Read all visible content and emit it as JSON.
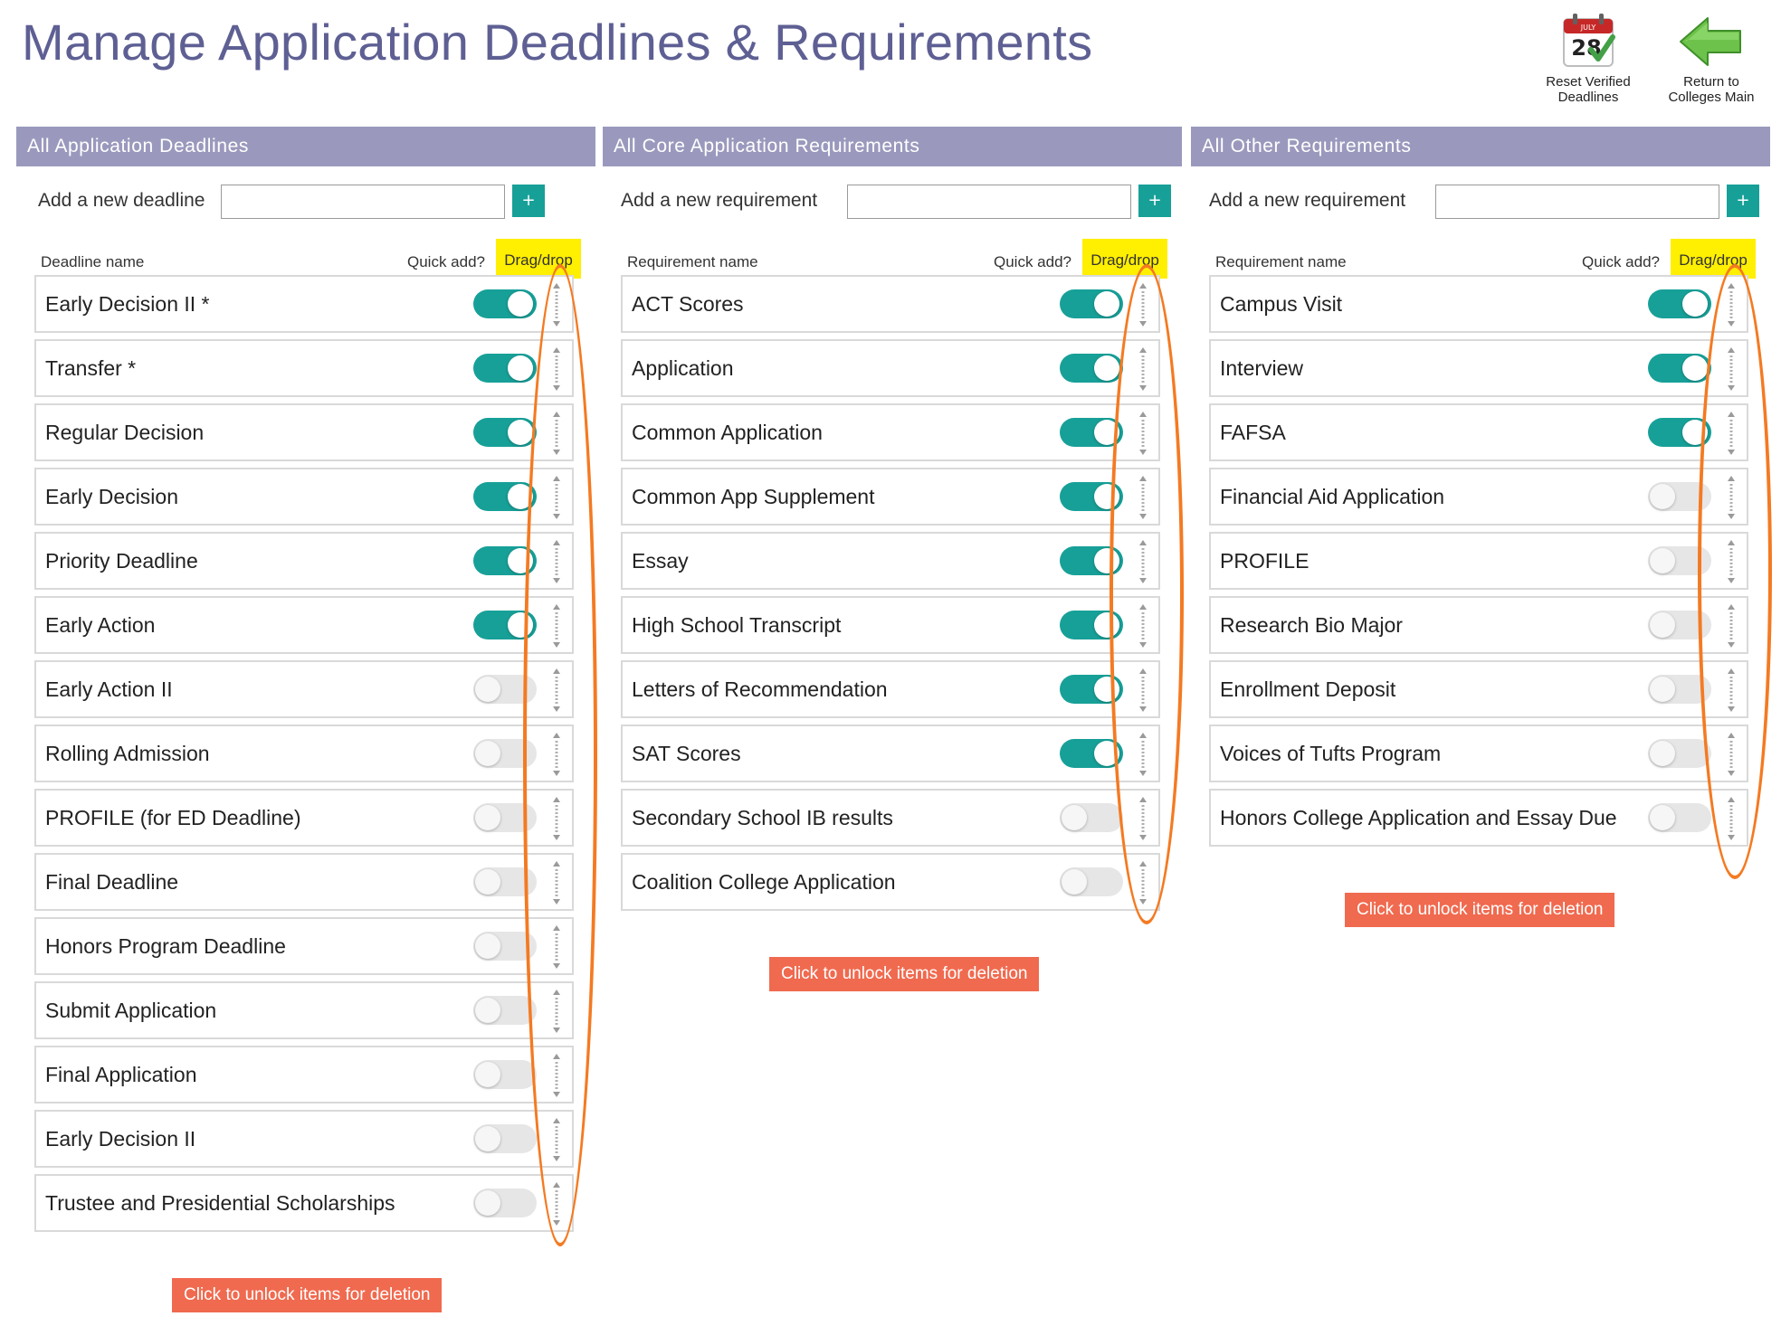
{
  "page": {
    "title": "Manage Application Deadlines & Requirements"
  },
  "top_actions": {
    "reset": {
      "label": "Reset Verified Deadlines",
      "icon": "calendar-check-icon",
      "cal_month": "JULY",
      "cal_day": "28"
    },
    "return": {
      "label": "Return to Colleges Main",
      "icon": "green-back-arrow-icon"
    }
  },
  "colors": {
    "accent": "#17a098",
    "header": "#9a99bd",
    "title": "#5e5f93",
    "unlock": "#f06a4f",
    "highlight": "#ffef00",
    "annotation": "#f47a22"
  },
  "panels": [
    {
      "title": "All Application Deadlines",
      "add_label": "Add a new deadline",
      "add_value": "",
      "add_button": "+",
      "col_name": "Deadline name",
      "col_quick": "Quick add?",
      "col_drag": "Drag/drop",
      "unlock_label": "Click to unlock items for deletion",
      "items": [
        {
          "label": "Early Decision II *",
          "on": true
        },
        {
          "label": "Transfer *",
          "on": true
        },
        {
          "label": "Regular Decision",
          "on": true
        },
        {
          "label": "Early Decision",
          "on": true
        },
        {
          "label": "Priority Deadline",
          "on": true
        },
        {
          "label": "Early Action",
          "on": true
        },
        {
          "label": "Early Action II",
          "on": false
        },
        {
          "label": "Rolling Admission",
          "on": false
        },
        {
          "label": "PROFILE (for ED Deadline)",
          "on": false
        },
        {
          "label": "Final Deadline",
          "on": false
        },
        {
          "label": "Honors Program Deadline",
          "on": false
        },
        {
          "label": "Submit Application",
          "on": false
        },
        {
          "label": "Final Application",
          "on": false
        },
        {
          "label": "Early Decision II",
          "on": false
        },
        {
          "label": "Trustee and Presidential Scholarships",
          "on": false
        }
      ]
    },
    {
      "title": "All Core Application Requirements",
      "add_label": "Add a new requirement",
      "add_value": "",
      "add_button": "+",
      "col_name": "Requirement name",
      "col_quick": "Quick add?",
      "col_drag": "Drag/drop",
      "unlock_label": "Click to unlock items for deletion",
      "items": [
        {
          "label": "ACT Scores",
          "on": true
        },
        {
          "label": "Application",
          "on": true
        },
        {
          "label": "Common Application",
          "on": true
        },
        {
          "label": "Common App Supplement",
          "on": true
        },
        {
          "label": "Essay",
          "on": true
        },
        {
          "label": "High School Transcript",
          "on": true
        },
        {
          "label": "Letters of Recommendation",
          "on": true
        },
        {
          "label": "SAT Scores",
          "on": true
        },
        {
          "label": "Secondary School IB results",
          "on": false
        },
        {
          "label": "Coalition College Application",
          "on": false
        }
      ]
    },
    {
      "title": "All Other Requirements",
      "add_label": "Add a new requirement",
      "add_value": "",
      "add_button": "+",
      "col_name": "Requirement name",
      "col_quick": "Quick add?",
      "col_drag": "Drag/drop",
      "unlock_label": "Click to unlock items for deletion",
      "items": [
        {
          "label": "Campus Visit",
          "on": true
        },
        {
          "label": "Interview",
          "on": true
        },
        {
          "label": "FAFSA",
          "on": true
        },
        {
          "label": "Financial Aid Application",
          "on": false
        },
        {
          "label": "PROFILE",
          "on": false
        },
        {
          "label": "Research Bio Major",
          "on": false
        },
        {
          "label": "Enrollment Deposit",
          "on": false
        },
        {
          "label": "Voices of Tufts Program",
          "on": false
        },
        {
          "label": "Honors College Application and Essay Due",
          "on": false
        }
      ]
    }
  ]
}
